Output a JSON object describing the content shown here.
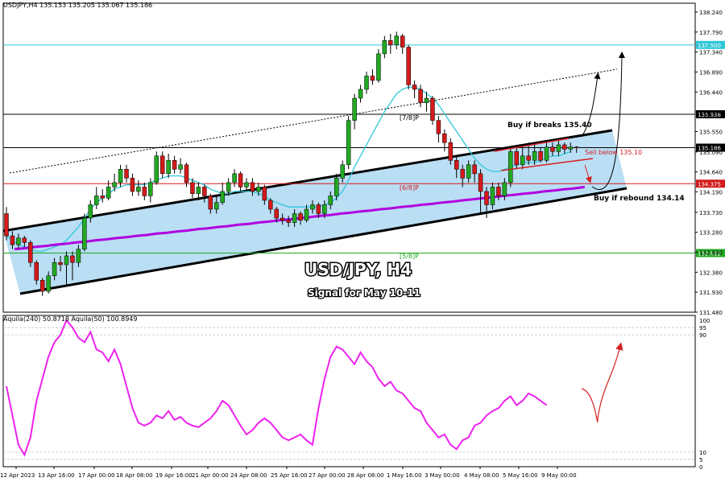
{
  "header": {
    "symbol_line": "USDJPY,H4  135.153 135.205 135.067 135.186",
    "indicator_line": "Aquila(240) 50.8718  Aquila(50) 100.8949"
  },
  "colors": {
    "bull": "#22aa22",
    "bear": "#d41a1a",
    "ma_fast": "#30c8d8",
    "ma_slow": "#b000e0",
    "channel_fill": "#aed8f2",
    "oscillator": "#ee22ee",
    "arrow_red": "#d42020"
  },
  "chart_data": [
    {
      "type": "candlestick",
      "title": "USD/JPY, H4",
      "subtitle": "Signal for May 10-11",
      "ylim": [
        131.48,
        138.24
      ],
      "y_ticks": [
        "138.240",
        "137.790",
        "137.340",
        "136.890",
        "136.440",
        "135.990",
        "135.550",
        "135.090",
        "134.640",
        "134.190",
        "133.730",
        "133.280",
        "132.830",
        "132.380",
        "131.930",
        "131.480"
      ],
      "x_ticks": [
        "12 Apr 2023",
        "13 Apr 16:00",
        "17 Apr 00:00",
        "18 Apr 08:00",
        "19 Apr 16:00",
        "21 Apr 00:00",
        "24 Apr 08:00",
        "25 Apr 16:00",
        "27 Apr 00:00",
        "28 Apr 08:00",
        "1 May 16:00",
        "3 May 00:00",
        "4 May 08:00",
        "5 May 16:00",
        "9 May 00:00"
      ],
      "price_levels": [
        {
          "value": 137.5,
          "label": "137.500",
          "color": "#30c8d8"
        },
        {
          "value": 135.938,
          "label": "135.938",
          "color": "#000000"
        },
        {
          "value": 135.186,
          "label": "135.186",
          "color": "#000000"
        },
        {
          "value": 134.375,
          "label": "134.375",
          "color": "#d41a1a"
        },
        {
          "value": 132.812,
          "label": "132.812",
          "color": "#22aa22"
        }
      ],
      "murrey_labels": [
        "[7/8]P",
        "[6/8]P",
        "[5/8]P"
      ],
      "candles": [
        [
          133.7,
          133.2,
          133.85,
          133.1
        ],
        [
          133.2,
          133.0,
          133.3,
          132.9
        ],
        [
          133.0,
          133.15,
          133.25,
          132.9
        ],
        [
          133.15,
          133.05,
          133.2,
          132.95
        ],
        [
          133.05,
          132.6,
          133.1,
          132.5
        ],
        [
          132.6,
          132.2,
          132.65,
          132.1
        ],
        [
          132.2,
          131.95,
          132.25,
          131.85
        ],
        [
          131.95,
          132.3,
          132.4,
          131.9
        ],
        [
          132.3,
          132.6,
          132.7,
          132.2
        ],
        [
          132.6,
          132.55,
          132.75,
          132.4
        ],
        [
          132.55,
          132.75,
          132.85,
          132.1
        ],
        [
          132.75,
          132.6,
          132.85,
          132.2
        ],
        [
          132.6,
          132.9,
          133.0,
          132.5
        ],
        [
          132.9,
          133.6,
          133.7,
          132.85
        ],
        [
          133.6,
          133.9,
          134.0,
          133.5
        ],
        [
          133.9,
          134.1,
          134.3,
          133.8
        ],
        [
          134.1,
          134.05,
          134.25,
          133.95
        ],
        [
          134.05,
          134.3,
          134.45,
          134.0
        ],
        [
          134.3,
          134.4,
          134.6,
          134.2
        ],
        [
          134.4,
          134.7,
          134.8,
          134.3
        ],
        [
          134.7,
          134.5,
          134.8,
          134.4
        ],
        [
          134.5,
          134.2,
          134.6,
          134.1
        ],
        [
          134.2,
          134.3,
          134.45,
          134.1
        ],
        [
          134.3,
          134.1,
          134.4,
          134.0
        ],
        [
          134.1,
          134.4,
          134.5,
          133.95
        ],
        [
          134.4,
          135.0,
          135.1,
          134.35
        ],
        [
          135.0,
          134.6,
          135.1,
          134.5
        ],
        [
          134.6,
          134.9,
          135.05,
          134.5
        ],
        [
          134.9,
          134.7,
          135.0,
          134.6
        ],
        [
          134.7,
          134.8,
          134.95,
          134.6
        ],
        [
          134.8,
          134.4,
          134.85,
          134.3
        ],
        [
          134.4,
          134.15,
          134.5,
          134.05
        ],
        [
          134.15,
          134.3,
          134.4,
          134.0
        ],
        [
          134.3,
          134.1,
          134.35,
          133.95
        ],
        [
          134.1,
          133.8,
          134.15,
          133.7
        ],
        [
          133.8,
          133.95,
          134.1,
          133.7
        ],
        [
          133.95,
          134.2,
          134.4,
          133.9
        ],
        [
          134.2,
          134.4,
          134.5,
          134.1
        ],
        [
          134.4,
          134.6,
          134.7,
          134.3
        ],
        [
          134.6,
          134.3,
          134.65,
          134.2
        ],
        [
          134.3,
          134.4,
          134.5,
          134.2
        ],
        [
          134.4,
          134.2,
          134.5,
          134.1
        ],
        [
          134.2,
          134.3,
          134.4,
          134.1
        ],
        [
          134.3,
          134.0,
          134.35,
          133.9
        ],
        [
          134.0,
          133.8,
          134.05,
          133.7
        ],
        [
          133.8,
          133.6,
          133.85,
          133.5
        ],
        [
          133.6,
          133.55,
          133.7,
          133.45
        ],
        [
          133.55,
          133.5,
          133.65,
          133.4
        ],
        [
          133.5,
          133.7,
          133.8,
          133.4
        ],
        [
          133.7,
          133.55,
          133.75,
          133.45
        ],
        [
          133.55,
          133.8,
          133.9,
          133.5
        ],
        [
          133.8,
          133.9,
          134.0,
          133.7
        ],
        [
          133.9,
          133.7,
          133.95,
          133.6
        ],
        [
          133.7,
          133.9,
          134.0,
          133.6
        ],
        [
          133.9,
          134.1,
          134.2,
          133.8
        ],
        [
          134.1,
          134.5,
          134.6,
          134.0
        ],
        [
          134.5,
          134.8,
          134.9,
          134.4
        ],
        [
          134.8,
          135.8,
          135.9,
          134.7
        ],
        [
          135.8,
          136.3,
          136.4,
          135.6
        ],
        [
          136.3,
          136.5,
          136.6,
          136.2
        ],
        [
          136.5,
          136.8,
          136.9,
          136.4
        ],
        [
          136.8,
          136.7,
          136.95,
          136.6
        ],
        [
          136.7,
          137.3,
          137.4,
          136.65
        ],
        [
          137.3,
          137.6,
          137.7,
          137.2
        ],
        [
          137.6,
          137.5,
          137.75,
          137.3
        ],
        [
          137.5,
          137.7,
          137.8,
          137.4
        ],
        [
          137.7,
          137.45,
          137.75,
          137.3
        ],
        [
          137.45,
          136.6,
          137.5,
          136.5
        ],
        [
          136.6,
          136.5,
          136.7,
          136.3
        ],
        [
          136.5,
          136.2,
          136.6,
          136.1
        ],
        [
          136.2,
          136.3,
          136.45,
          136.0
        ],
        [
          136.3,
          135.8,
          136.35,
          135.7
        ],
        [
          135.8,
          135.5,
          135.9,
          135.3
        ],
        [
          135.5,
          135.3,
          135.6,
          135.1
        ],
        [
          135.3,
          134.9,
          135.4,
          134.8
        ],
        [
          134.9,
          134.7,
          135.0,
          134.5
        ],
        [
          134.7,
          134.5,
          134.8,
          134.3
        ],
        [
          134.5,
          134.8,
          134.9,
          134.4
        ],
        [
          134.8,
          134.6,
          134.9,
          134.4
        ],
        [
          134.6,
          134.2,
          134.7,
          133.7
        ],
        [
          134.2,
          133.9,
          134.3,
          133.6
        ],
        [
          133.9,
          134.3,
          134.4,
          133.8
        ],
        [
          134.3,
          134.1,
          134.4,
          134.0
        ],
        [
          134.1,
          134.4,
          134.5,
          134.0
        ],
        [
          134.4,
          135.1,
          135.2,
          134.3
        ],
        [
          135.1,
          134.8,
          135.2,
          134.7
        ],
        [
          134.8,
          135.0,
          135.2,
          134.7
        ],
        [
          135.0,
          134.9,
          135.3,
          134.8
        ],
        [
          134.9,
          135.1,
          135.25,
          134.8
        ],
        [
          135.1,
          134.9,
          135.2,
          134.85
        ],
        [
          134.9,
          135.2,
          135.3,
          134.85
        ],
        [
          135.2,
          135.1,
          135.3,
          135.0
        ],
        [
          135.1,
          135.25,
          135.35,
          135.0
        ],
        [
          135.25,
          135.15,
          135.3,
          135.05
        ],
        [
          135.15,
          135.2,
          135.3,
          135.07
        ],
        [
          135.2,
          135.19,
          135.22,
          135.07
        ]
      ],
      "ma_fast": [
        133.2,
        133.1,
        133.0,
        132.95,
        132.9,
        132.85,
        132.85,
        132.9,
        132.95,
        133.0,
        133.1,
        133.25,
        133.4,
        133.6,
        133.8,
        133.95,
        134.05,
        134.15,
        134.25,
        134.3,
        134.35,
        134.35,
        134.35,
        134.35,
        134.4,
        134.45,
        134.5,
        134.55,
        134.55,
        134.55,
        134.5,
        134.45,
        134.4,
        134.35,
        134.25,
        134.2,
        134.15,
        134.15,
        134.2,
        134.2,
        134.2,
        134.2,
        134.15,
        134.1,
        134.0,
        133.95,
        133.9,
        133.85,
        133.85,
        133.85,
        133.85,
        133.85,
        133.85,
        133.9,
        133.95,
        134.05,
        134.2,
        134.45,
        134.75,
        135.0,
        135.25,
        135.5,
        135.75,
        136.0,
        136.2,
        136.4,
        136.5,
        136.55,
        136.55,
        136.5,
        136.4,
        136.3,
        136.15,
        135.95,
        135.75,
        135.55,
        135.35,
        135.15,
        134.95,
        134.8,
        134.7,
        134.65,
        134.65,
        134.7,
        134.75,
        134.8,
        134.85,
        134.85,
        134.85,
        134.9,
        134.95,
        135.0,
        135.0,
        135.05,
        135.1
      ],
      "ma_slow": [
        132.9,
        132.92,
        132.95,
        132.97,
        133.0,
        133.02,
        133.05,
        133.07,
        133.1,
        133.12,
        133.15,
        133.17,
        133.2,
        133.22,
        133.25,
        133.27,
        133.3,
        133.32,
        133.35,
        133.37,
        133.4,
        133.42,
        133.45,
        133.47,
        133.5,
        133.52,
        133.55,
        133.57,
        133.6,
        133.62,
        133.65,
        133.67,
        133.7,
        133.72,
        133.75,
        133.77,
        133.8,
        133.82,
        133.85,
        133.87,
        133.9,
        133.92,
        133.95,
        133.97,
        134.0,
        134.02,
        134.05,
        134.07,
        134.1,
        134.12,
        134.15,
        134.17,
        134.2,
        134.22,
        134.25,
        134.27,
        134.3
      ],
      "annotations": [
        "Buy if breaks 135.40",
        "Sell below 135.10",
        "Buy if rebound 134.14"
      ]
    },
    {
      "type": "line",
      "name": "Aquila oscillator",
      "ylim": [
        0,
        100
      ],
      "y_ticks": [
        "100",
        "95",
        "90",
        "10",
        "5",
        "0"
      ],
      "values": [
        55,
        35,
        15,
        8,
        20,
        45,
        60,
        75,
        85,
        90,
        100,
        95,
        88,
        85,
        92,
        80,
        78,
        72,
        80,
        70,
        55,
        40,
        30,
        28,
        30,
        35,
        33,
        38,
        32,
        34,
        30,
        28,
        27,
        30,
        33,
        38,
        45,
        42,
        35,
        28,
        22,
        25,
        30,
        33,
        30,
        25,
        20,
        18,
        20,
        22,
        18,
        15,
        40,
        60,
        75,
        82,
        80,
        75,
        70,
        78,
        72,
        68,
        60,
        55,
        58,
        52,
        50,
        45,
        40,
        38,
        30,
        25,
        20,
        22,
        15,
        12,
        18,
        20,
        28,
        30,
        35,
        38,
        40,
        45,
        48,
        42,
        45,
        50,
        48,
        45,
        42
      ]
    }
  ]
}
